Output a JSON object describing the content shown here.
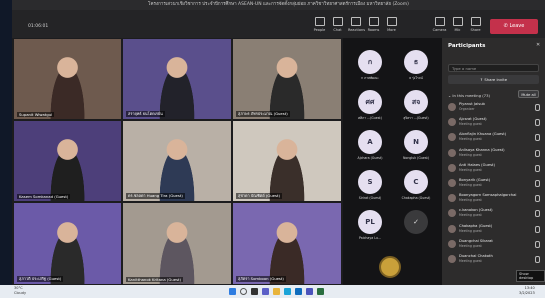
{
  "window": {
    "title": "โครงการเสวนาเชิงวิชาการ ประจำปีการศึกษา ASEAN-UN และการจัดตั้งกลุ่มย่อย ภาควิชาวิทยาศาสตร์การเมือง มหาวิทยาลัย (Zoom)",
    "timer": "01:06:01"
  },
  "toolbar": {
    "items": [
      "People",
      "Chat",
      "Reactions",
      "Rooms",
      "More",
      "Camera",
      "Mic",
      "Share"
    ],
    "leave_label": "Leave",
    "accent": "#c4314b"
  },
  "tiles": [
    {
      "name": "Supanit Wiwatgul",
      "bg": "#6e5a4e",
      "person": "#3b2a26"
    },
    {
      "name": "สรายุทธ์ ธนโตดเรย์น",
      "bg": "#5a4f8c",
      "person": "#22222a"
    },
    {
      "name": "สุภาพร ภัทรประมาณ (Guest)",
      "bg": "#8a7f74",
      "person": "#2a2a2a"
    },
    {
      "name": "Kasem Somkanad (Guest)",
      "bg": "#4d3f7a",
      "person": "#1f1f1f"
    },
    {
      "name": "ดร.ชลลดา Huang Tira (Guest)",
      "bg": "#b9b0a6",
      "person": "#2e3a55"
    },
    {
      "name": "สุชาดา บัณฑิตย์ (Guest)",
      "bg": "#cfc8be",
      "person": "#3a2f2a"
    },
    {
      "name": "สุภาวดี ประเสริฐ (Guest)",
      "bg": "#6b5aa8",
      "person": "#2a2a2a"
    },
    {
      "name": "Kanitthanok Kritana (Guest)",
      "bg": "#a39a90",
      "person": "#5d5660"
    },
    {
      "name": "สุภัตรา Somboon (Guest)",
      "bg": "#7a68b0",
      "person": "#3a2a26"
    }
  ],
  "gallery": [
    {
      "initials": "ก",
      "name": "ก ภาสพัฒนะ"
    },
    {
      "initials": "ธ",
      "name": "ธ รุ่งโรจน์"
    },
    {
      "initials": "ศศ",
      "name": "ศศิภา ...(Guest)"
    },
    {
      "initials": "สจ",
      "name": "สุจิตรา ...(Guest)"
    },
    {
      "initials": "A",
      "name": "Ajchara (Guest)"
    },
    {
      "initials": "N",
      "name": "Nongluk (Guest)"
    },
    {
      "initials": "S",
      "name": "Sirirat (Guest)"
    },
    {
      "initials": "C",
      "name": "Chakapha (Guest)"
    },
    {
      "initials": "PL",
      "name": "Paichaya Lu..."
    },
    {
      "initials": "✓",
      "name": ""
    }
  ],
  "participants": {
    "title": "Participants",
    "search_placeholder": "Type a name",
    "share_invite": "Share invite",
    "in_meeting": "In this meeting (73)",
    "mute_all": "Mute all",
    "list": [
      {
        "name": "Piyanut Jaisub",
        "role": "Organizer"
      },
      {
        "name": "Ajcsrat (Guest)",
        "role": "Meeting guest"
      },
      {
        "name": "Alonflajin Khuana (Guest)",
        "role": "Meeting guest"
      },
      {
        "name": "Anlisaya Khanna (Guest)",
        "role": "Meeting guest"
      },
      {
        "name": "Anti Halaes (Guest)",
        "role": "Meeting guest"
      },
      {
        "name": "Bonyarik (Guest)",
        "role": "Meeting guest"
      },
      {
        "name": "Boonyagorn Somsaphalgorchai",
        "role": "Meeting guest"
      },
      {
        "name": "c.kanokon (Guest)",
        "role": "Meeting guest"
      },
      {
        "name": "Chakapha (Guest)",
        "role": "Meeting guest"
      },
      {
        "name": "Duangchai Sikarat",
        "role": "Meeting guest"
      },
      {
        "name": "Duanchai Chakoth",
        "role": "Meeting guest"
      }
    ],
    "tooltip": "Show desktop"
  },
  "taskbar": {
    "weather_temp": "30°C",
    "weather_desc": "Cloudy",
    "time": "13:40",
    "date": "3/2/2023"
  }
}
